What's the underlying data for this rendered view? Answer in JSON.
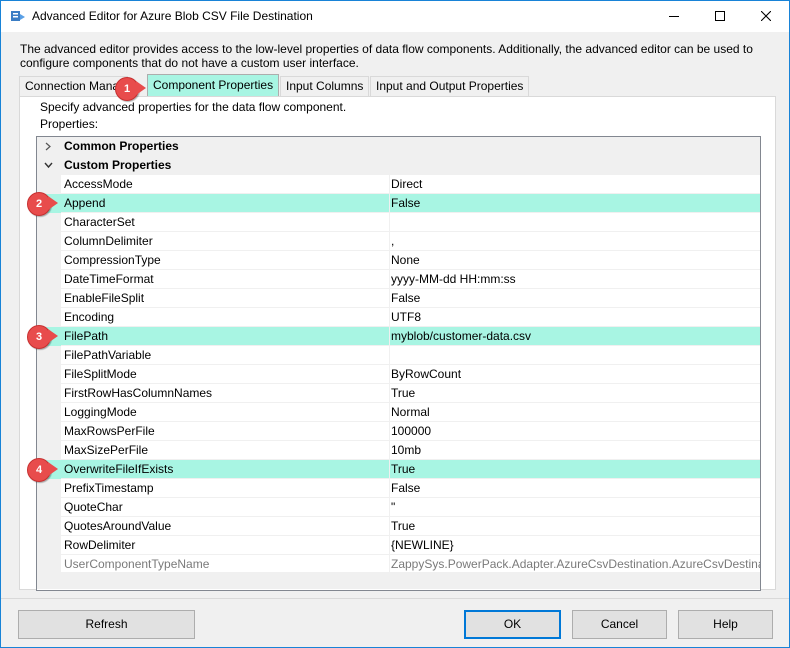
{
  "window": {
    "title": "Advanced Editor for Azure Blob CSV File Destination",
    "description": "The advanced editor provides access to the low-level properties of data flow components. Additionally, the advanced editor can be used to configure components that do not have a custom user interface."
  },
  "tabs": [
    {
      "label": "Connection Managers"
    },
    {
      "label": "Component Properties"
    },
    {
      "label": "Input Columns"
    },
    {
      "label": "Input and Output Properties"
    }
  ],
  "panel": {
    "description": "Specify advanced properties for the data flow component.",
    "properties_label": "Properties:"
  },
  "grid": {
    "categories": [
      {
        "label": "Common Properties",
        "expanded": false
      },
      {
        "label": "Custom Properties",
        "expanded": true
      }
    ],
    "rows": [
      {
        "name": "AccessMode",
        "value": "Direct"
      },
      {
        "name": "Append",
        "value": "False",
        "highlighted": true
      },
      {
        "name": "CharacterSet",
        "value": ""
      },
      {
        "name": "ColumnDelimiter",
        "value": ","
      },
      {
        "name": "CompressionType",
        "value": "None"
      },
      {
        "name": "DateTimeFormat",
        "value": "yyyy-MM-dd HH:mm:ss"
      },
      {
        "name": "EnableFileSplit",
        "value": "False"
      },
      {
        "name": "Encoding",
        "value": "UTF8"
      },
      {
        "name": "FilePath",
        "value": "myblob/customer-data.csv",
        "highlighted": true
      },
      {
        "name": "FilePathVariable",
        "value": ""
      },
      {
        "name": "FileSplitMode",
        "value": "ByRowCount"
      },
      {
        "name": "FirstRowHasColumnNames",
        "value": "True"
      },
      {
        "name": "LoggingMode",
        "value": "Normal"
      },
      {
        "name": "MaxRowsPerFile",
        "value": "100000"
      },
      {
        "name": "MaxSizePerFile",
        "value": "10mb"
      },
      {
        "name": "OverwriteFileIfExists",
        "value": "True",
        "highlighted": true
      },
      {
        "name": "PrefixTimestamp",
        "value": "False"
      },
      {
        "name": "QuoteChar",
        "value": "\""
      },
      {
        "name": "QuotesAroundValue",
        "value": "True"
      },
      {
        "name": "RowDelimiter",
        "value": "{NEWLINE}"
      },
      {
        "name": "UserComponentTypeName",
        "value": "ZappySys.PowerPack.Adapter.AzureCsvDestination.AzureCsvDestinati",
        "muted": true
      }
    ]
  },
  "badges": [
    "1",
    "2",
    "3",
    "4"
  ],
  "buttons": {
    "refresh": "Refresh",
    "ok": "OK",
    "cancel": "Cancel",
    "help": "Help"
  },
  "colors": {
    "highlight": "#a8f5e3",
    "badge": "#e84c4c",
    "accent": "#0078d7"
  }
}
